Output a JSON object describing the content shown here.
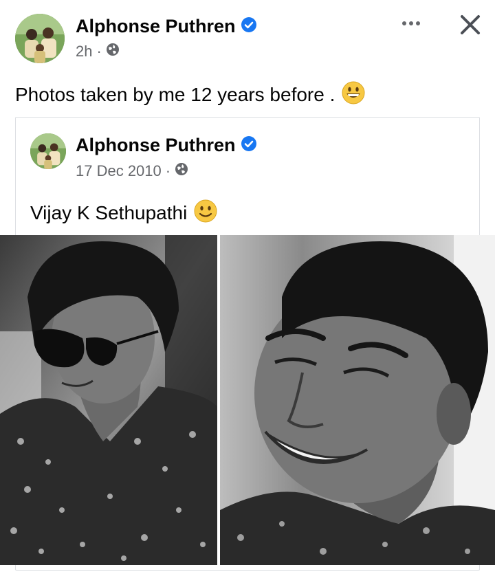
{
  "post": {
    "author": "Alphonse Puthren",
    "time": "2h",
    "separator": "·",
    "text": "Photos taken by me 12 years before .",
    "emoji_icon": "grinning-face-icon"
  },
  "toolbar": {
    "more_icon": "more-options-icon",
    "close_icon": "close-icon"
  },
  "shared_post": {
    "author": "Alphonse Puthren",
    "date": "17 Dec 2010",
    "separator": "·",
    "text": "Vijay K Sethupathi",
    "emoji_icon": "slightly-smiling-face-icon"
  },
  "photos": [
    {
      "subject": "man-in-sunglasses-photo"
    },
    {
      "subject": "man-smiling-photo"
    }
  ],
  "colors": {
    "verified_blue": "#1877f2",
    "secondary_text": "#65676b",
    "primary_text": "#050505",
    "emoji_yellow": "#f7c843"
  }
}
